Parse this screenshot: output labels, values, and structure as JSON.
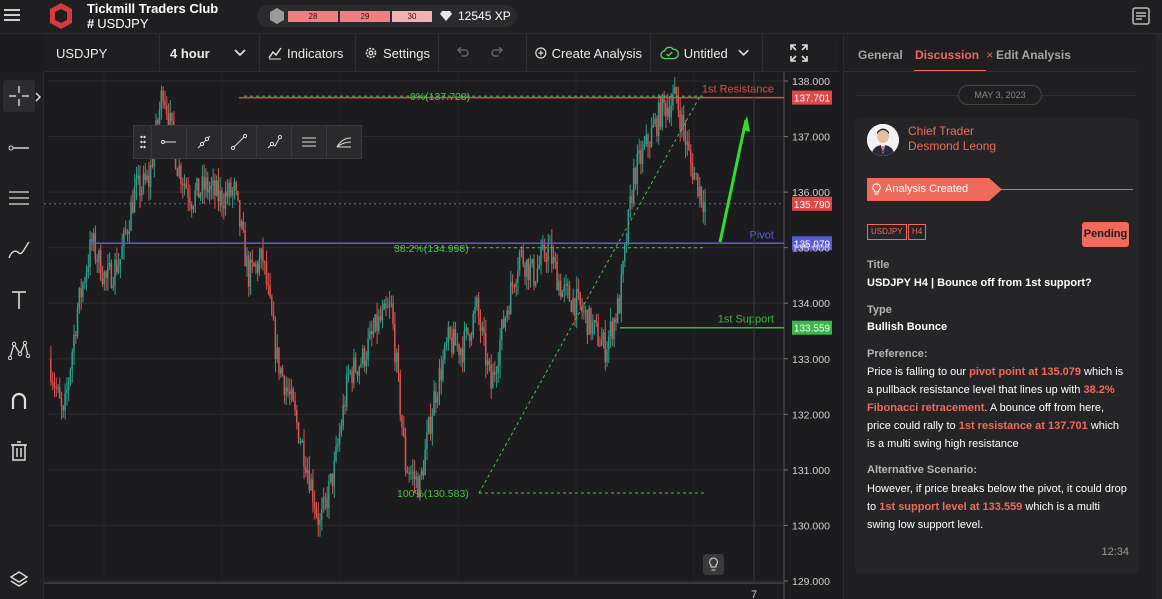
{
  "app": {
    "title": "Tickmill Traders Club",
    "channel_prefix": "#",
    "channel": "USDJPY"
  },
  "xp": {
    "segments": [
      "28",
      "29",
      "30"
    ],
    "value": "12545 XP"
  },
  "toolbar": {
    "symbol": "USDJPY",
    "interval": "4 hour",
    "indicators": "Indicators",
    "settings": "Settings",
    "create_analysis": "Create Analysis",
    "layout_name": "Untitled"
  },
  "left_tools": [
    "crosshair-icon",
    "horizontal-line-icon",
    "fib-lines-icon",
    "brush-icon",
    "text-icon",
    "pattern-icon",
    "magnet-icon",
    "trash-icon",
    "layers-icon"
  ],
  "draw_tools": [
    "drag-handle-icon",
    "horizontal-ray-icon",
    "trend-line-icon",
    "extended-line-icon",
    "info-line-icon",
    "parallel-channel-icon",
    "regression-icon"
  ],
  "chart_data": {
    "type": "candlestick",
    "symbol": "USDJPY",
    "interval": "4 hour",
    "ylim": [
      129.0,
      138.0
    ],
    "y_ticks": [
      "138.000",
      "137.000",
      "136.000",
      "135.000",
      "134.000",
      "133.000",
      "132.000",
      "131.000",
      "130.000",
      "129.000"
    ],
    "x_ticks": [
      "7"
    ],
    "levels": [
      {
        "name": "1st Resistance",
        "value": 137.701,
        "label": "137.701",
        "color": "#e04848"
      },
      {
        "name": "Pivot",
        "value": 135.079,
        "label": "135.079",
        "color": "#5b5bd6"
      },
      {
        "name": "1st Support",
        "value": 133.559,
        "label": "133.559",
        "color": "#39b54a"
      }
    ],
    "current_price": {
      "value": 135.79,
      "label": "135.790"
    },
    "fibonacci": [
      {
        "level": "0%",
        "value": 137.728,
        "label": "0%(137.728)"
      },
      {
        "level": "38.2%",
        "value": 134.998,
        "label": "38.2%(134.998)"
      },
      {
        "level": "100%",
        "value": 130.583,
        "label": "100%(130.583)"
      }
    ],
    "price_path": [
      133.0,
      131.9,
      133.9,
      135.1,
      134.4,
      134.8,
      136.0,
      136.2,
      137.9,
      136.5,
      135.9,
      136.1,
      135.9,
      136.0,
      134.5,
      134.8,
      133.0,
      132.2,
      131.2,
      130.0,
      131.0,
      132.7,
      133.0,
      133.6,
      133.9,
      131.1,
      130.7,
      132.3,
      133.3,
      133.2,
      133.9,
      132.5,
      133.8,
      134.9,
      134.5,
      135.0,
      134.2,
      134.0,
      133.6,
      133.2,
      134.0,
      136.3,
      136.9,
      137.5,
      137.7,
      136.5,
      135.8
    ]
  },
  "panel": {
    "tabs": [
      "General",
      "Discussion",
      "Edit Analysis"
    ],
    "date": "MAY 3, 2023",
    "author_role": "Chief Trader",
    "author_name": "Desmond Leong",
    "status_ribbon": "Analysis Created",
    "tags": [
      "USDJPY",
      "H4"
    ],
    "status": "Pending",
    "title_label": "Title",
    "title": "USDJPY H4 | Bounce off from 1st support?",
    "type_label": "Type",
    "type": "Bullish Bounce",
    "preference_label": "Preference:",
    "preference": {
      "p1": "Price is falling to our ",
      "h1": "pivot point at 135.079",
      "p2": " which is a pullback resistance level that lines up with ",
      "h2": "38.2% Fibonacci retracement",
      "p3": ". A bounce off from here, price could rally to ",
      "h3": "1st resistance at 137.701",
      "p4": " which is a multi swing high resistance"
    },
    "alt_label": "Alternative Scenario:",
    "alternative": {
      "p1": "However, if price breaks below the pivot, it could drop to ",
      "h1": "1st support level at 133.559",
      "p2": " which is a multi swing low support level."
    },
    "time": "12:34"
  }
}
